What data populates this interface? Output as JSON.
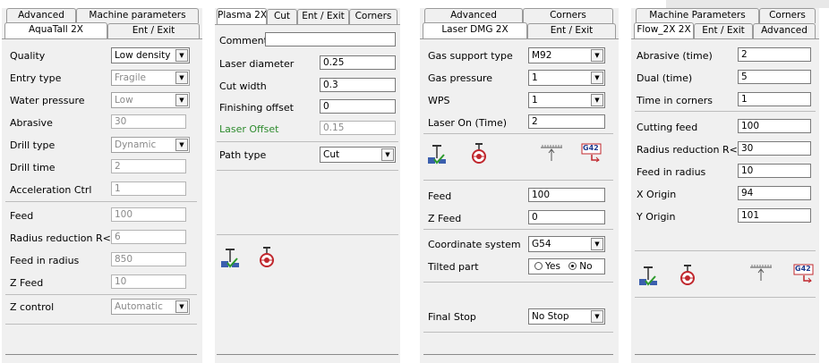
{
  "panel1": {
    "tabs_back": [
      "Advanced",
      "Machine parameters"
    ],
    "tab_active": "AquaTall 2X",
    "tab_other": "Ent / Exit",
    "quality": {
      "label": "Quality",
      "value": "Low density"
    },
    "entry_type": {
      "label": "Entry type",
      "value": "Fragile"
    },
    "water_pressure": {
      "label": "Water pressure",
      "value": "Low"
    },
    "abrasive": {
      "label": "Abrasive",
      "value": "30"
    },
    "drill_type": {
      "label": "Drill type",
      "value": "Dynamic"
    },
    "drill_time": {
      "label": "Drill time",
      "value": "2"
    },
    "accel_ctrl": {
      "label": "Acceleration Ctrl",
      "value": "1"
    },
    "feed": {
      "label": "Feed",
      "value": "100"
    },
    "radius_reduction": {
      "label": "Radius reduction R<=",
      "value": "6"
    },
    "feed_in_radius": {
      "label": "Feed in radius",
      "value": "850"
    },
    "z_feed": {
      "label": "Z Feed",
      "value": "10"
    },
    "z_control": {
      "label": "Z control",
      "value": "Automatic"
    }
  },
  "panel2": {
    "tabs": [
      "Plasma 2X",
      "Cut",
      "Ent / Exit",
      "Corners"
    ],
    "comment": {
      "label": "Comment",
      "value": ""
    },
    "laser_diameter": {
      "label": "Laser diameter",
      "value": "0.25"
    },
    "cut_width": {
      "label": "Cut width",
      "value": "0.3"
    },
    "finishing_offset": {
      "label": "Finishing offset",
      "value": "0"
    },
    "laser_offset": {
      "label": "Laser Offset",
      "value": "0.15"
    },
    "path_type": {
      "label": "Path type",
      "value": "Cut"
    }
  },
  "panel3": {
    "tabs_back": [
      "Advanced",
      "Corners"
    ],
    "tab_active": "Laser DMG 2X",
    "tab_other": "Ent / Exit",
    "gas_support_type": {
      "label": "Gas support type",
      "value": "M92"
    },
    "gas_pressure": {
      "label": "Gas pressure",
      "value": "1"
    },
    "wps": {
      "label": "WPS",
      "value": "1"
    },
    "laser_on_time": {
      "label": "Laser On (Time)",
      "value": "2"
    },
    "g42_text": "G42",
    "feed": {
      "label": "Feed",
      "value": "100"
    },
    "z_feed": {
      "label": "Z Feed",
      "value": "0"
    },
    "coordinate_system": {
      "label": "Coordinate system",
      "value": "G54"
    },
    "tilted_part": {
      "label": "Tilted part",
      "yes": "Yes",
      "no": "No",
      "selected": "No"
    },
    "final_stop": {
      "label": "Final Stop",
      "value": "No Stop"
    }
  },
  "panel4": {
    "tabs_back": [
      "Machine Parameters",
      "Corners"
    ],
    "tabs": [
      "Flow_2X 2X",
      "Ent / Exit",
      "Advanced"
    ],
    "abrasive_time": {
      "label": "Abrasive (time)",
      "value": "2"
    },
    "dual_time": {
      "label": "Dual (time)",
      "value": "5"
    },
    "time_in_corners": {
      "label": "Time in corners",
      "value": "1"
    },
    "cutting_feed": {
      "label": "Cutting feed",
      "value": "100"
    },
    "radius_reduction": {
      "label": "Radius reduction R<=",
      "value": "30"
    },
    "feed_in_radius": {
      "label": "Feed in radius",
      "value": "10"
    },
    "x_origin": {
      "label": "X Origin",
      "value": "94"
    },
    "y_origin": {
      "label": "Y Origin",
      "value": "101"
    },
    "g42_text": "G42"
  }
}
